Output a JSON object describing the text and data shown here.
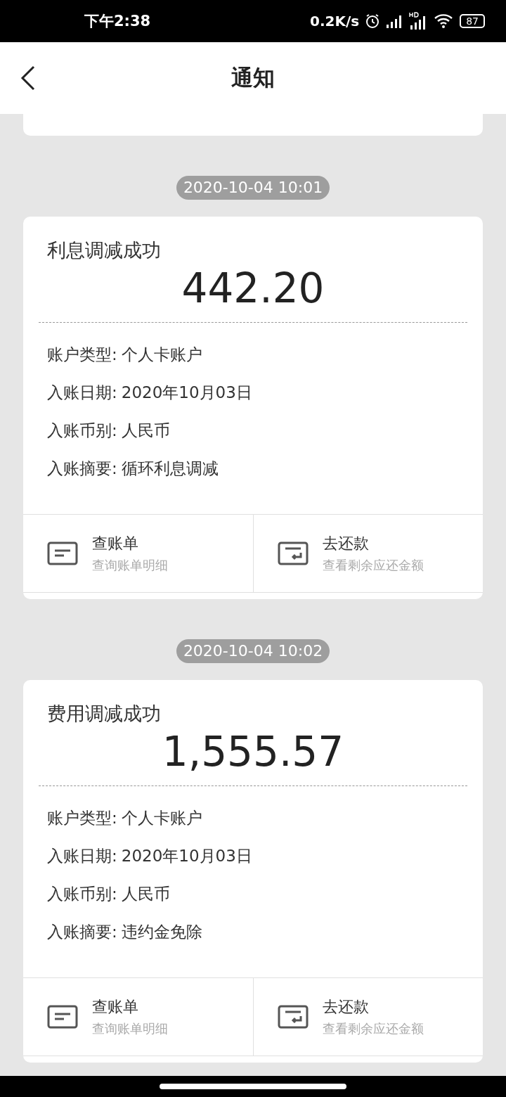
{
  "status_bar": {
    "time": "下午2:38",
    "speed": "0.2K/s",
    "battery": "87"
  },
  "header": {
    "title": "通知"
  },
  "notifications": [
    {
      "time": "2020-10-04 10:01",
      "title": "利息调减成功",
      "amount": "442.20",
      "fields": [
        {
          "label": "账户类型:",
          "value": "个人卡账户"
        },
        {
          "label": "入账日期:",
          "value": "2020年10月03日"
        },
        {
          "label": "入账币别:",
          "value": "人民币"
        },
        {
          "label": "入账摘要:",
          "value": "循环利息调减"
        }
      ],
      "actions": [
        {
          "kind": "bill",
          "label": "查账单",
          "hint": "查询账单明细"
        },
        {
          "kind": "repay",
          "label": "去还款",
          "hint": "查看剩余应还金额"
        }
      ]
    },
    {
      "time": "2020-10-04 10:02",
      "title": "费用调减成功",
      "amount": "1,555.57",
      "fields": [
        {
          "label": "账户类型:",
          "value": "个人卡账户"
        },
        {
          "label": "入账日期:",
          "value": "2020年10月03日"
        },
        {
          "label": "入账币别:",
          "value": "人民币"
        },
        {
          "label": "入账摘要:",
          "value": "违约金免除"
        }
      ],
      "actions": [
        {
          "kind": "bill",
          "label": "查账单",
          "hint": "查询账单明细"
        },
        {
          "kind": "repay",
          "label": "去还款",
          "hint": "查看剩余应还金额"
        }
      ]
    }
  ]
}
